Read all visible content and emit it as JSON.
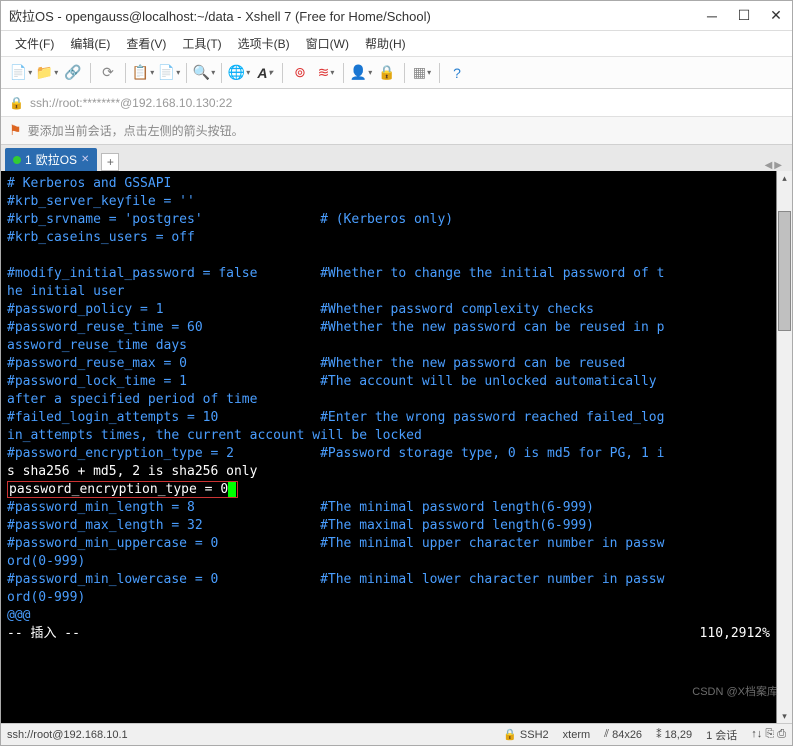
{
  "window": {
    "title": "欧拉OS - opengauss@localhost:~/data - Xshell 7 (Free for Home/School)"
  },
  "menu": {
    "file": "文件(F)",
    "edit": "编辑(E)",
    "view": "查看(V)",
    "tools": "工具(T)",
    "tab": "选项卡(B)",
    "window": "窗口(W)",
    "help": "帮助(H)"
  },
  "address": {
    "text": "ssh://root:********@192.168.10.130:22"
  },
  "hint": {
    "text": "要添加当前会话，点击左侧的箭头按钮。"
  },
  "tab": {
    "index": "1",
    "label": "欧拉OS"
  },
  "terminal": {
    "l01": "# Kerberos and GSSAPI",
    "l02": "#krb_server_keyfile = ''",
    "l03": "#krb_srvname = 'postgres'               # (Kerberos only)",
    "l04": "#krb_caseins_users = off",
    "l05": "",
    "l06": "#modify_initial_password = false        #Whether to change the initial password of t",
    "l07": "he initial user",
    "l08": "#password_policy = 1                    #Whether password complexity checks",
    "l09": "#password_reuse_time = 60               #Whether the new password can be reused in p",
    "l10": "assword_reuse_time days",
    "l11": "#password_reuse_max = 0                 #Whether the new password can be reused",
    "l12": "#password_lock_time = 1                 #The account will be unlocked automatically ",
    "l13": "after a specified period of time",
    "l14": "#failed_login_attempts = 10             #Enter the wrong password reached failed_log",
    "l15": "in_attempts times, the current account will be locked",
    "l16": "#password_encryption_type = 2           #Password storage type, 0 is md5 for PG, 1 i",
    "l17a": "s sha256 + md5, 2 is sha256 only",
    "l17b": "password_encryption_type = 0",
    "l18": "#password_min_length = 8                #The minimal password length(6-999)",
    "l19": "#password_max_length = 32               #The maximal password length(6-999)",
    "l20": "#password_min_uppercase = 0             #The minimal upper character number in passw",
    "l21": "ord(0-999)",
    "l22": "#password_min_lowercase = 0             #The minimal lower character number in passw",
    "l23": "ord(0-999)",
    "l24": "@@@",
    "mode": "-- 插入 --",
    "pos": "110,29",
    "pct": "12%"
  },
  "status": {
    "path": "ssh://root@192.168.10.1",
    "proto": "SSH2",
    "term": "xterm",
    "size_icon": "⫽",
    "size": "84x26",
    "cursor_icon": "⁑",
    "cursor": "18,29",
    "sessions": "1 会话",
    "extra": "↑↓ ⎘ ⎙"
  },
  "watermark": "CSDN @X档案库"
}
